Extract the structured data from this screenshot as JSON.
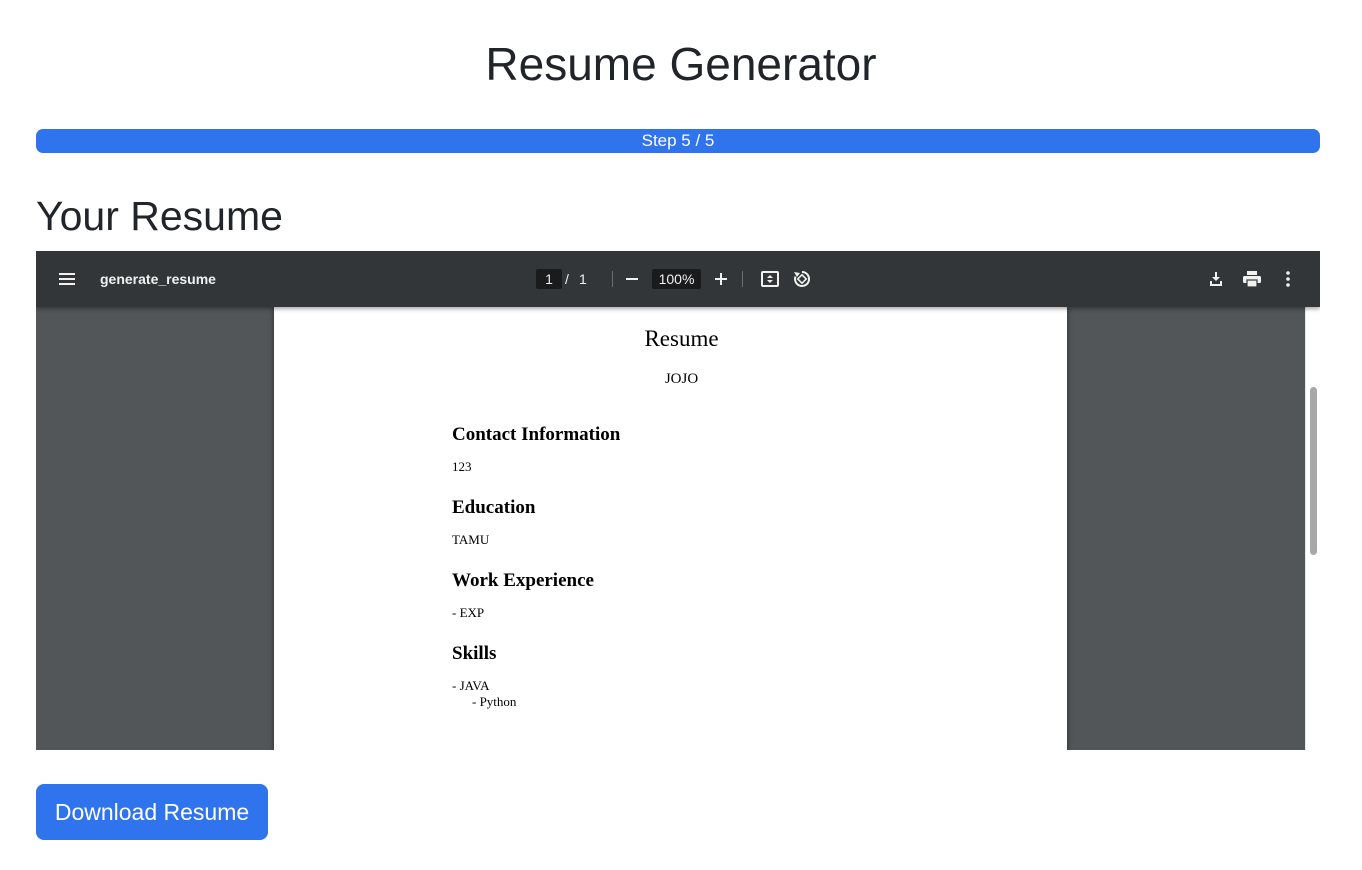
{
  "header": {
    "title": "Resume Generator"
  },
  "progress": {
    "label": "Step 5 / 5",
    "current_step": 5,
    "total_steps": 5,
    "fraction": 1.0,
    "color": "#2f74ed"
  },
  "section": {
    "title": "Your Resume"
  },
  "pdf_viewer": {
    "toolbar": {
      "menu_icon": "hamburger-menu-icon",
      "document_title": "generate_resume",
      "current_page": "1",
      "page_separator": "/",
      "total_pages": "1",
      "zoom_out_icon": "minus-icon",
      "zoom_level": "100%",
      "zoom_in_icon": "plus-icon",
      "fit_page_icon": "fit-to-page-icon",
      "rotate_icon": "rotate-icon",
      "download_icon": "download-icon",
      "print_icon": "print-icon",
      "more_icon": "more-vertical-icon",
      "background": "#323639"
    },
    "document": {
      "heading": "Resume",
      "name": "JOJO",
      "sections": [
        {
          "title": "Contact Information",
          "lines": [
            "123"
          ]
        },
        {
          "title": "Education",
          "lines": [
            "TAMU"
          ]
        },
        {
          "title": "Work Experience",
          "lines": [
            "- EXP"
          ]
        },
        {
          "title": "Skills",
          "lines": [
            "- JAVA",
            "- Python"
          ]
        }
      ]
    }
  },
  "actions": {
    "download_label": "Download Resume"
  }
}
